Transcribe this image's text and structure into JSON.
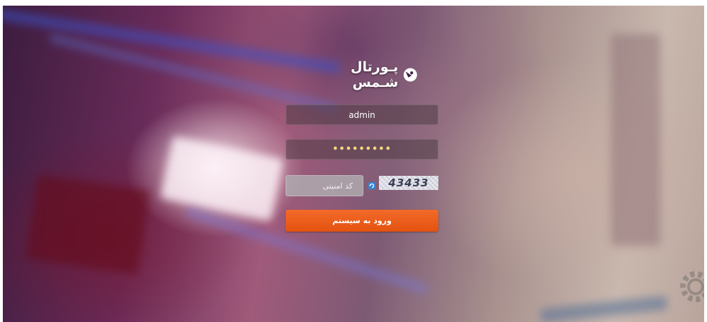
{
  "brand": {
    "name": "پـورتال شـمس",
    "logo_icon": "logo-mark-icon",
    "accent_color": "#ffffff"
  },
  "login_form": {
    "username_value": "admin",
    "password_value": "•••••••••",
    "captcha_placeholder": "کد امنیتی",
    "captcha_code": "43433",
    "refresh_icon": "refresh-icon",
    "submit_label": "ورود به سیستم",
    "submit_color": "#f26a2a"
  }
}
